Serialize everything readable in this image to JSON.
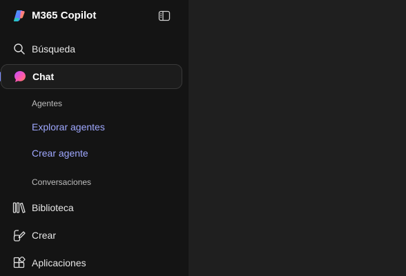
{
  "app": {
    "title": "M365 Copilot"
  },
  "nav": {
    "search": "Búsqueda",
    "chat": "Chat",
    "agents_section": "Agentes",
    "explore_agents": "Explorar agentes",
    "create_agent": "Crear agente",
    "conversations_section": "Conversaciones",
    "library": "Biblioteca",
    "create": "Crear",
    "apps": "Aplicaciones"
  },
  "colors": {
    "sidebar_bg": "#141414",
    "main_bg": "#1f1f1f",
    "link": "#9fa8ff",
    "accent": "#7b8cff"
  },
  "icons": {
    "logo": "m365-copilot-logo-icon",
    "collapse": "sidebar-toggle-icon",
    "search": "search-icon",
    "chat": "chat-bubble-icon",
    "library": "library-icon",
    "create": "create-icon",
    "apps": "apps-icon"
  }
}
